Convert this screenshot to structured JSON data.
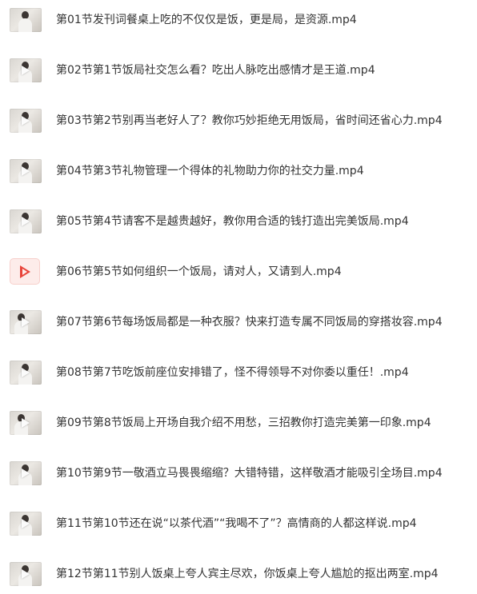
{
  "files": [
    {
      "name": "第01节发刊词餐桌上吃的不仅仅是饭，更是局，是资源.mp4",
      "thumb": "video-thumbnail"
    },
    {
      "name": "第02节第1节饭局社交怎么看？吃出人脉吃出感情才是王道.mp4",
      "thumb": "video-thumbnail"
    },
    {
      "name": "第03节第2节别再当老好人了？教你巧妙拒绝无用饭局，省时间还省心力.mp4",
      "thumb": "video-thumbnail"
    },
    {
      "name": "第04节第3节礼物管理一个得体的礼物助力你的社交力量.mp4",
      "thumb": "video-thumbnail"
    },
    {
      "name": "第05节第4节请客不是越贵越好，教你用合适的钱打造出完美饭局.mp4",
      "thumb": "video-thumbnail"
    },
    {
      "name": "第06节第5节如何组织一个饭局，请对人，又请到人.mp4",
      "thumb": "video-file-icon"
    },
    {
      "name": "第07节第6节每场饭局都是一种衣服？快来打造专属不同饭局的穿搭妆容.mp4",
      "thumb": "video-thumbnail"
    },
    {
      "name": "第08节第7节吃饭前座位安排错了，怪不得领导不对你委以重任！.mp4",
      "thumb": "video-thumbnail"
    },
    {
      "name": "第09节第8节饭局上开场自我介绍不用愁，三招教你打造完美第一印象.mp4",
      "thumb": "video-thumbnail"
    },
    {
      "name": "第10节第9节一敬酒立马畏畏缩缩？大错特错，这样敬酒才能吸引全场目.mp4",
      "thumb": "video-thumbnail"
    },
    {
      "name": "第11节第10节还在说“以茶代酒”“我喝不了”？高情商的人都这样说.mp4",
      "thumb": "video-thumbnail"
    },
    {
      "name": "第12节第11节别人饭桌上夸人宾主尽欢，你饭桌上夸人尴尬的抠出两室.mp4",
      "thumb": "video-thumbnail"
    }
  ],
  "colors": {
    "text": "#333333",
    "video_icon_bg": "#fdecea",
    "video_icon_accent": "#e8443a"
  }
}
